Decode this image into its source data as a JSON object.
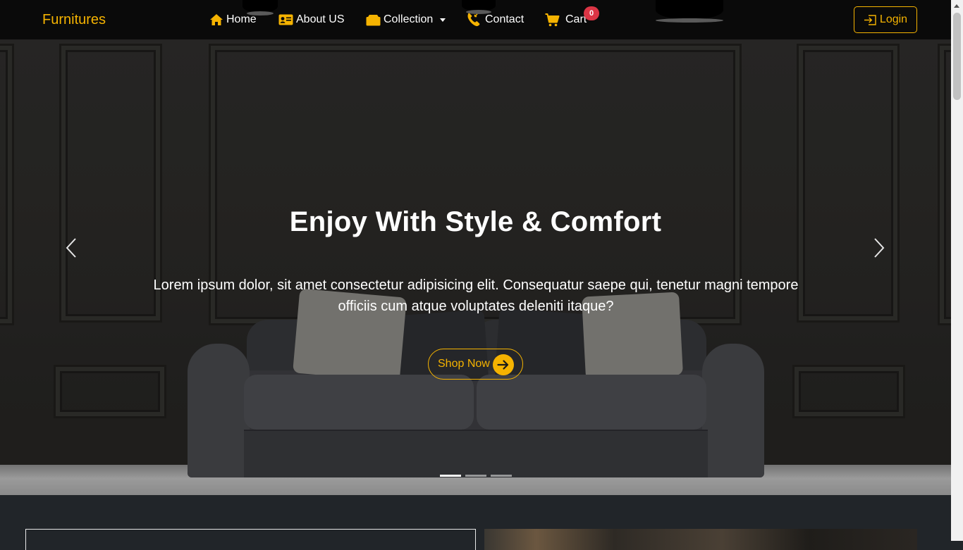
{
  "brand": "Furnitures",
  "nav": {
    "home": "Home",
    "about": "About US",
    "collection": "Collection",
    "contact": "Contact",
    "cart": "Cart",
    "cart_count": "0",
    "login": "Login"
  },
  "hero": {
    "title": "Enjoy With Style & Comfort",
    "text": "Lorem ipsum dolor, sit amet consectetur adipisicing elit. Consequatur saepe qui, tenetur magni tempore officiis cum atque voluptates deleniti itaque?",
    "button": "Shop Now",
    "slides": 3,
    "active_slide": 1
  },
  "colors": {
    "accent": "#f5b301",
    "navbar": "#0a0a0a",
    "badge": "#dc3545",
    "page_bg": "#212529"
  },
  "icons": {
    "home": "home-icon",
    "about": "id-card-icon",
    "collection": "folder-icon",
    "contact": "phone-icon",
    "cart": "cart-icon",
    "login": "login-icon",
    "shop": "arrow-right-circle-icon",
    "prev": "chevron-left-icon",
    "next": "chevron-right-icon"
  }
}
